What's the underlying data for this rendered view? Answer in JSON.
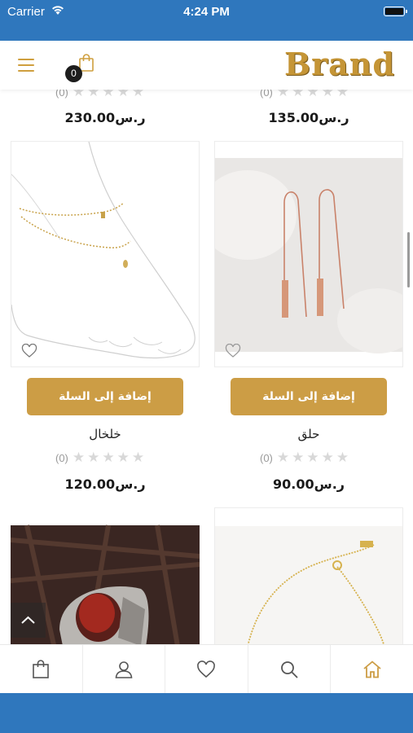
{
  "status_bar": {
    "carrier": "Carrier",
    "time": "4:24 PM"
  },
  "header": {
    "brand": "Brand",
    "cart_count": "0",
    "accent_color": "#cc9d45"
  },
  "products_top": [
    {
      "rating_count": "(0)",
      "price": "ر.س230.00"
    },
    {
      "rating_count": "(0)",
      "price": "ر.س135.00"
    }
  ],
  "products_middle": [
    {
      "name": "خلخال",
      "add_to_cart": "إضافة إلى السلة",
      "rating_count": "(0)",
      "price": "ر.س120.00",
      "image": "gold anklet on foot sketch"
    },
    {
      "name": "حلق",
      "add_to_cart": "إضافة إلى السلة",
      "rating_count": "(0)",
      "price": "ر.س90.00",
      "image": "rose gold bar threader earrings"
    }
  ],
  "products_bottom": [
    {
      "image": "silver ring with red agate stone"
    },
    {
      "image": "gold chain bracelet"
    }
  ],
  "tabbar": [
    {
      "icon": "bag-icon"
    },
    {
      "icon": "user-icon"
    },
    {
      "icon": "heart-icon"
    },
    {
      "icon": "search-icon"
    },
    {
      "icon": "home-icon"
    }
  ],
  "colors": {
    "status_bar": "#2f77bd",
    "gold": "#cc9d45",
    "active_tab": "#cc9d45",
    "inactive_tab": "#555555"
  }
}
